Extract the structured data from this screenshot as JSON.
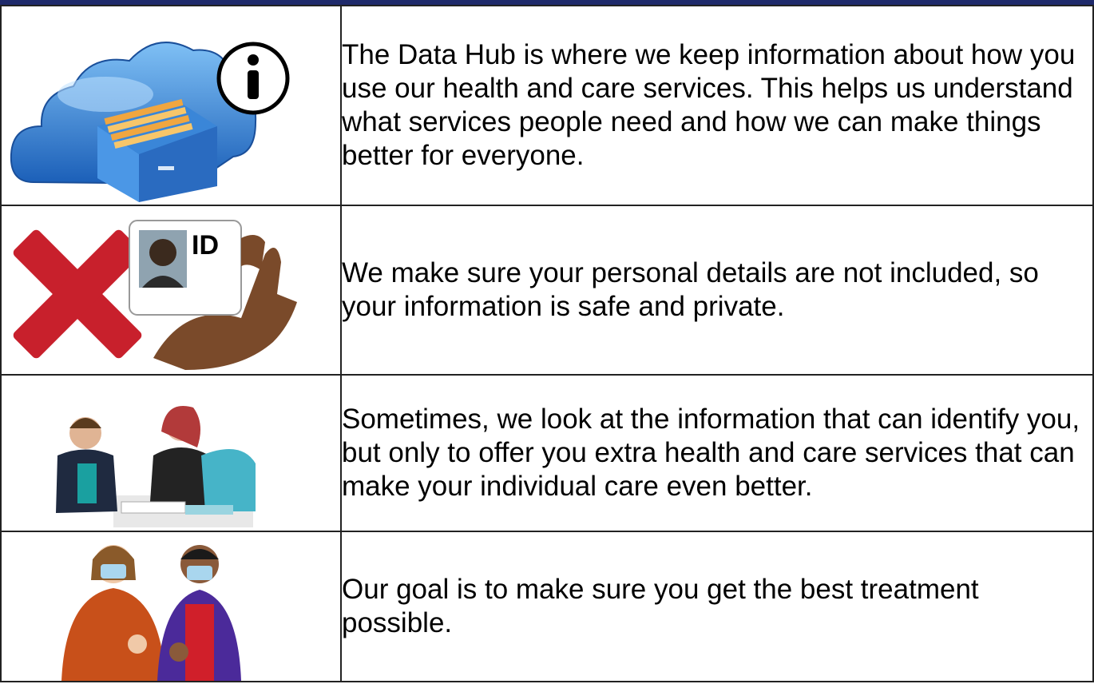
{
  "rows": [
    {
      "icons": [
        "cloud-filing-cabinet-icon",
        "info-icon"
      ],
      "text": "The Data Hub is where we keep information about how you use our health and care services. This helps us understand what services people need and how we can make things better for everyone."
    },
    {
      "icons": [
        "red-cross-icon",
        "id-card-icon"
      ],
      "id_card_label": "ID",
      "text": "We make sure your personal details are not included, so your information is safe and private."
    },
    {
      "icons": [
        "people-at-computer-illustration"
      ],
      "text": "Sometimes, we look at the information that can identify you, but only to offer you extra health and care services that can make your individual care even better."
    },
    {
      "icons": [
        "masked-people-thumbs-up-illustration"
      ],
      "text": "Our goal is to make sure you get the best treatment possible."
    }
  ],
  "colors": {
    "header_bar": "#1f2a6b",
    "border": "#222222",
    "cross_red": "#c8202c",
    "cloud_blue": "#2e7fd6"
  }
}
